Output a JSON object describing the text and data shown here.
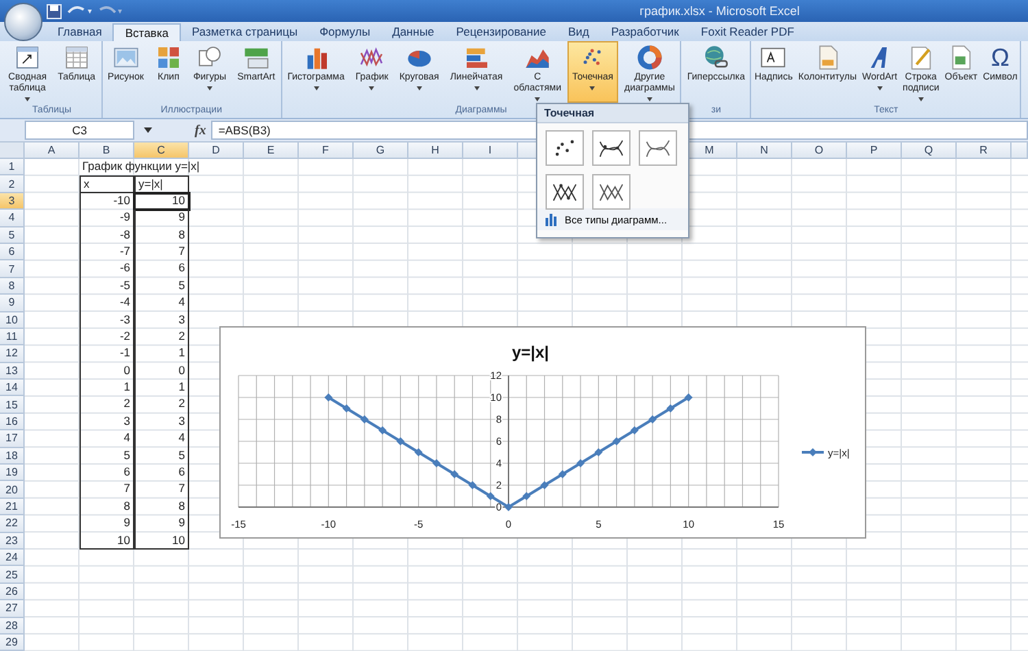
{
  "window": {
    "title": "график.xlsx - Microsoft Excel"
  },
  "tabs": [
    {
      "label": "Главная",
      "selected": false
    },
    {
      "label": "Вставка",
      "selected": true
    },
    {
      "label": "Разметка страницы",
      "selected": false
    },
    {
      "label": "Формулы",
      "selected": false
    },
    {
      "label": "Данные",
      "selected": false
    },
    {
      "label": "Рецензирование",
      "selected": false
    },
    {
      "label": "Вид",
      "selected": false
    },
    {
      "label": "Разработчик",
      "selected": false
    },
    {
      "label": "Foxit Reader PDF",
      "selected": false
    }
  ],
  "ribbon": {
    "groups": [
      {
        "label": "Таблицы",
        "buttons": [
          {
            "label": "Сводная таблица",
            "has_menu": true,
            "selected": false
          },
          {
            "label": "Таблица",
            "has_menu": false,
            "selected": false
          }
        ]
      },
      {
        "label": "Иллюстрации",
        "buttons": [
          {
            "label": "Рисунок",
            "has_menu": false,
            "selected": false
          },
          {
            "label": "Клип",
            "has_menu": false,
            "selected": false
          },
          {
            "label": "Фигуры",
            "has_menu": true,
            "selected": false
          },
          {
            "label": "SmartArt",
            "has_menu": false,
            "selected": false
          }
        ]
      },
      {
        "label": "Диаграммы",
        "buttons": [
          {
            "label": "Гистограмма",
            "has_menu": true,
            "selected": false
          },
          {
            "label": "График",
            "has_menu": true,
            "selected": false
          },
          {
            "label": "Круговая",
            "has_menu": true,
            "selected": false
          },
          {
            "label": "Линейчатая",
            "has_menu": true,
            "selected": false
          },
          {
            "label": "С областями",
            "has_menu": true,
            "selected": false
          },
          {
            "label": "Точечная",
            "has_menu": true,
            "selected": true
          },
          {
            "label": "Другие диаграммы",
            "has_menu": true,
            "selected": false
          }
        ]
      },
      {
        "label": "зи",
        "buttons": [
          {
            "label": "Гиперссылка",
            "has_menu": false,
            "selected": false
          }
        ]
      },
      {
        "label": "Текст",
        "buttons": [
          {
            "label": "Надпись",
            "has_menu": false,
            "selected": false
          },
          {
            "label": "Колонтитулы",
            "has_menu": false,
            "selected": false
          },
          {
            "label": "WordArt",
            "has_menu": true,
            "selected": false
          },
          {
            "label": "Строка подписи",
            "has_menu": true,
            "selected": false
          },
          {
            "label": "Объект",
            "has_menu": false,
            "selected": false
          },
          {
            "label": "Символ",
            "has_menu": false,
            "selected": false,
            "icon_text": "Ω"
          }
        ]
      }
    ]
  },
  "dropdown": {
    "title": "Точечная",
    "footer": "Все типы диаграмм..."
  },
  "formula_bar": {
    "name_box": "C3",
    "fx_label": "fx",
    "formula": "=ABS(B3)"
  },
  "sheet": {
    "columns": [
      {
        "label": "A",
        "selected": false
      },
      {
        "label": "B",
        "selected": false
      },
      {
        "label": "C",
        "selected": true
      },
      {
        "label": "D",
        "selected": false
      },
      {
        "label": "E",
        "selected": false
      },
      {
        "label": "F",
        "selected": false
      },
      {
        "label": "G",
        "selected": false
      },
      {
        "label": "H",
        "selected": false
      },
      {
        "label": "I",
        "selected": false
      },
      {
        "label": "M",
        "selected": false
      },
      {
        "label": "N",
        "selected": false
      },
      {
        "label": "O",
        "selected": false
      },
      {
        "label": "P",
        "selected": false
      },
      {
        "label": "Q",
        "selected": false
      },
      {
        "label": "R",
        "selected": false
      }
    ],
    "rows": [
      {
        "header": "1",
        "selected": false,
        "boxed": false,
        "cells": [
          {
            "text": "График функции y=|x|",
            "selected": false
          }
        ]
      },
      {
        "header": "2",
        "selected": false,
        "boxed": true,
        "cells": [
          {
            "text": "x",
            "selected": false
          },
          {
            "text": "y=|x|",
            "selected": false
          }
        ]
      },
      {
        "header": "3",
        "selected": true,
        "boxed": true,
        "cells": [
          {
            "text": "-10",
            "selected": false
          },
          {
            "text": "10",
            "selected": true
          }
        ]
      },
      {
        "header": "4",
        "selected": false,
        "boxed": true,
        "cells": [
          {
            "text": "-9",
            "selected": false
          },
          {
            "text": "9",
            "selected": false
          }
        ]
      },
      {
        "header": "5",
        "selected": false,
        "boxed": true,
        "cells": [
          {
            "text": "-8",
            "selected": false
          },
          {
            "text": "8",
            "selected": false
          }
        ]
      },
      {
        "header": "6",
        "selected": false,
        "boxed": true,
        "cells": [
          {
            "text": "-7",
            "selected": false
          },
          {
            "text": "7",
            "selected": false
          }
        ]
      },
      {
        "header": "7",
        "selected": false,
        "boxed": true,
        "cells": [
          {
            "text": "-6",
            "selected": false
          },
          {
            "text": "6",
            "selected": false
          }
        ]
      },
      {
        "header": "8",
        "selected": false,
        "boxed": true,
        "cells": [
          {
            "text": "-5",
            "selected": false
          },
          {
            "text": "5",
            "selected": false
          }
        ]
      },
      {
        "header": "9",
        "selected": false,
        "boxed": true,
        "cells": [
          {
            "text": "-4",
            "selected": false
          },
          {
            "text": "4",
            "selected": false
          }
        ]
      },
      {
        "header": "10",
        "selected": false,
        "boxed": true,
        "cells": [
          {
            "text": "-3",
            "selected": false
          },
          {
            "text": "3",
            "selected": false
          }
        ]
      },
      {
        "header": "11",
        "selected": false,
        "boxed": true,
        "cells": [
          {
            "text": "-2",
            "selected": false
          },
          {
            "text": "2",
            "selected": false
          }
        ]
      },
      {
        "header": "12",
        "selected": false,
        "boxed": true,
        "cells": [
          {
            "text": "-1",
            "selected": false
          },
          {
            "text": "1",
            "selected": false
          }
        ]
      },
      {
        "header": "13",
        "selected": false,
        "boxed": true,
        "cells": [
          {
            "text": "0",
            "selected": false
          },
          {
            "text": "0",
            "selected": false
          }
        ]
      },
      {
        "header": "14",
        "selected": false,
        "boxed": true,
        "cells": [
          {
            "text": "1",
            "selected": false
          },
          {
            "text": "1",
            "selected": false
          }
        ]
      },
      {
        "header": "15",
        "selected": false,
        "boxed": true,
        "cells": [
          {
            "text": "2",
            "selected": false
          },
          {
            "text": "2",
            "selected": false
          }
        ]
      },
      {
        "header": "16",
        "selected": false,
        "boxed": true,
        "cells": [
          {
            "text": "3",
            "selected": false
          },
          {
            "text": "3",
            "selected": false
          }
        ]
      },
      {
        "header": "17",
        "selected": false,
        "boxed": true,
        "cells": [
          {
            "text": "4",
            "selected": false
          },
          {
            "text": "4",
            "selected": false
          }
        ]
      },
      {
        "header": "18",
        "selected": false,
        "boxed": true,
        "cells": [
          {
            "text": "5",
            "selected": false
          },
          {
            "text": "5",
            "selected": false
          }
        ]
      },
      {
        "header": "19",
        "selected": false,
        "boxed": true,
        "cells": [
          {
            "text": "6",
            "selected": false
          },
          {
            "text": "6",
            "selected": false
          }
        ]
      },
      {
        "header": "20",
        "selected": false,
        "boxed": true,
        "cells": [
          {
            "text": "7",
            "selected": false
          },
          {
            "text": "7",
            "selected": false
          }
        ]
      },
      {
        "header": "21",
        "selected": false,
        "boxed": true,
        "cells": [
          {
            "text": "8",
            "selected": false
          },
          {
            "text": "8",
            "selected": false
          }
        ]
      },
      {
        "header": "22",
        "selected": false,
        "boxed": true,
        "cells": [
          {
            "text": "9",
            "selected": false
          },
          {
            "text": "9",
            "selected": false
          }
        ]
      },
      {
        "header": "23",
        "selected": false,
        "boxed": true,
        "cells": [
          {
            "text": "10",
            "selected": false
          },
          {
            "text": "10",
            "selected": false
          }
        ]
      },
      {
        "header": "24",
        "selected": false,
        "boxed": false,
        "cells": []
      },
      {
        "header": "25",
        "selected": false,
        "boxed": false,
        "cells": []
      },
      {
        "header": "26",
        "selected": false,
        "boxed": false,
        "cells": []
      },
      {
        "header": "27",
        "selected": false,
        "boxed": false,
        "cells": []
      },
      {
        "header": "28",
        "selected": false,
        "boxed": false,
        "cells": []
      },
      {
        "header": "29",
        "selected": false,
        "boxed": false,
        "cells": []
      }
    ]
  },
  "chart": {
    "chart_data": {
      "type": "line",
      "title": "y=|x|",
      "grid": true,
      "x": [
        -10,
        -9,
        -8,
        -7,
        -6,
        -5,
        -4,
        -3,
        -2,
        -1,
        0,
        1,
        2,
        3,
        4,
        5,
        6,
        7,
        8,
        9,
        10
      ],
      "series": [
        {
          "name": "y=|x|",
          "color": "#4a7ebb",
          "marker": "diamond",
          "values": [
            10,
            9,
            8,
            7,
            6,
            5,
            4,
            3,
            2,
            1,
            0,
            1,
            2,
            3,
            4,
            5,
            6,
            7,
            8,
            9,
            10
          ]
        }
      ],
      "xlim": [
        -15,
        15
      ],
      "ylim": [
        0,
        12
      ],
      "xticks": [
        -15,
        -10,
        -5,
        0,
        5,
        10,
        15
      ],
      "yticks": [
        0,
        2,
        4,
        6,
        8,
        10,
        12
      ]
    }
  }
}
